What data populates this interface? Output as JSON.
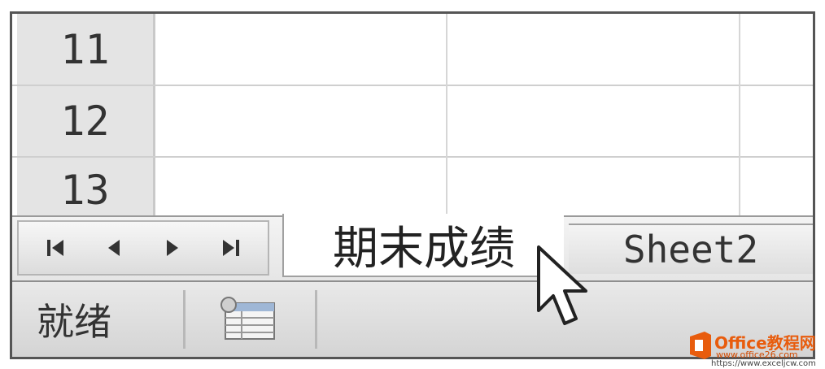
{
  "rows": [
    {
      "number": "11"
    },
    {
      "number": "12"
    },
    {
      "number": "13"
    }
  ],
  "sheet_tabs": {
    "active": "期末成绩",
    "inactive": "Sheet2"
  },
  "status_bar": {
    "status": "就绪"
  },
  "watermark": {
    "brand": "Office教程网",
    "url1": "www.office26.com",
    "url2": "https://www.exceljcw.com"
  },
  "icons": {
    "nav": [
      "first-sheet-icon",
      "previous-sheet-icon",
      "next-sheet-icon",
      "last-sheet-icon"
    ],
    "macro": "record-macro-icon",
    "cursor": "mouse-pointer-icon"
  },
  "colors": {
    "row_header_bg": "#e4e4e4",
    "gridline": "#cfcfcf",
    "watermark_accent": "#e85c0d"
  }
}
